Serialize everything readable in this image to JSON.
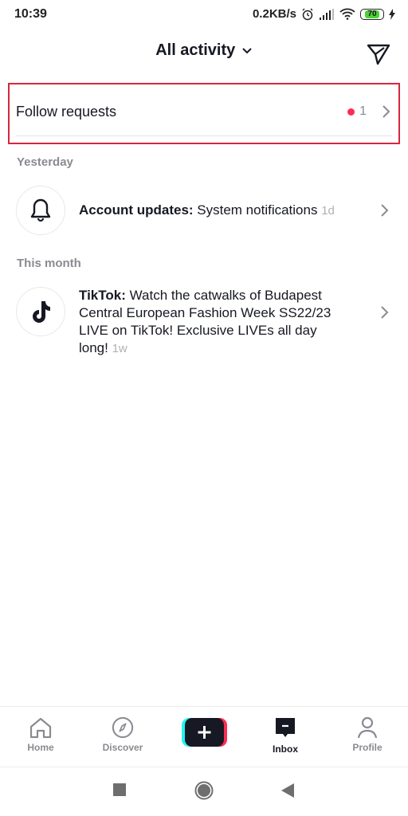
{
  "status_bar": {
    "time": "10:39",
    "network_speed": "0.2KB/s",
    "battery_level": "70",
    "icons": [
      "alarm-icon",
      "signal-icon",
      "wifi-icon",
      "battery-icon",
      "charging-icon"
    ]
  },
  "header": {
    "title": "All activity",
    "dropdown_icon": "chevron-down-icon",
    "action_icon": "send-icon"
  },
  "follow_requests": {
    "label": "Follow requests",
    "count": "1",
    "highlight_color": "#d7263d",
    "dot_color": "#fe2c55"
  },
  "sections": [
    {
      "label": "Yesterday",
      "items": [
        {
          "icon": "bell-icon",
          "title": "Account updates:",
          "body": " System notifications ",
          "time": "1d"
        }
      ]
    },
    {
      "label": "This month",
      "items": [
        {
          "icon": "tiktok-logo-icon",
          "title": "TikTok:",
          "body": " Watch the catwalks of Budapest Central European Fashion Week SS22/23 LIVE on TikTok! Exclusive LIVEs all day long! ",
          "time": "1w"
        }
      ]
    }
  ],
  "tab_bar": {
    "tabs": [
      {
        "label": "Home",
        "icon": "home-icon",
        "active": false
      },
      {
        "label": "Discover",
        "icon": "compass-icon",
        "active": false
      },
      {
        "label": "",
        "icon": "plus-icon",
        "active": false
      },
      {
        "label": "Inbox",
        "icon": "inbox-icon",
        "active": true
      },
      {
        "label": "Profile",
        "icon": "profile-icon",
        "active": false
      }
    ]
  },
  "system_nav": {
    "buttons": [
      "recents-button",
      "home-button",
      "back-button"
    ]
  }
}
